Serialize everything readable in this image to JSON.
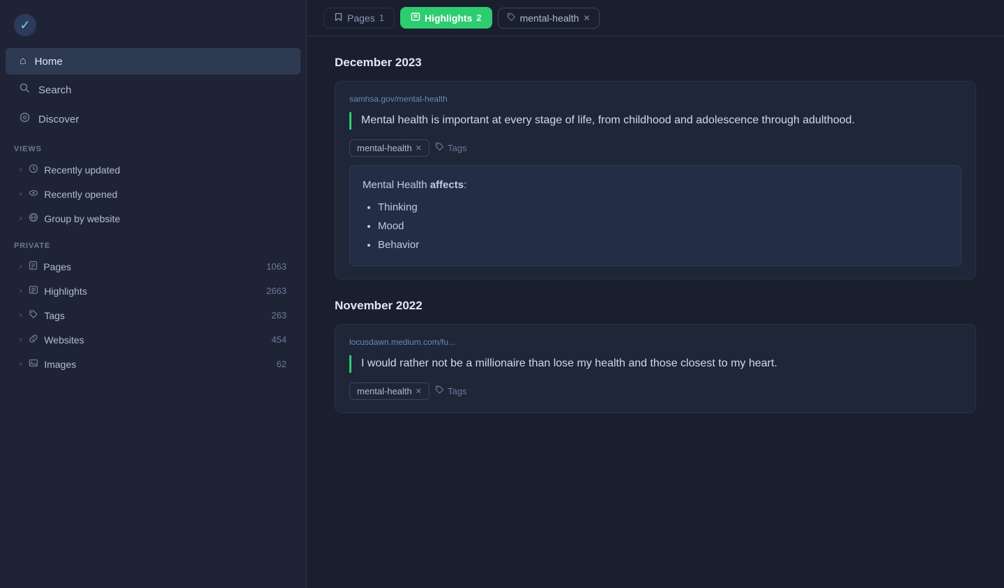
{
  "app": {
    "logo": "☁"
  },
  "sidebar": {
    "nav": [
      {
        "id": "home",
        "icon": "⌂",
        "label": "Home",
        "active": false
      },
      {
        "id": "search",
        "icon": "○",
        "label": "Search",
        "active": false
      },
      {
        "id": "discover",
        "icon": "◎",
        "label": "Discover",
        "active": false
      }
    ],
    "views_label": "Views",
    "views": [
      {
        "id": "recently-updated",
        "icon": "⊙",
        "label": "Recently updated"
      },
      {
        "id": "recently-opened",
        "icon": "◉",
        "label": "Recently opened"
      },
      {
        "id": "group-by-website",
        "icon": "⊕",
        "label": "Group by website"
      }
    ],
    "private_label": "Private",
    "private_items": [
      {
        "id": "pages",
        "icon": "📄",
        "label": "Pages",
        "count": "1063"
      },
      {
        "id": "highlights",
        "icon": "❝",
        "label": "Highlights",
        "count": "2663"
      },
      {
        "id": "tags",
        "icon": "🏷",
        "label": "Tags",
        "count": "263"
      },
      {
        "id": "websites",
        "icon": "🔗",
        "label": "Websites",
        "count": "454"
      },
      {
        "id": "images",
        "icon": "🖼",
        "label": "Images",
        "count": "62"
      }
    ]
  },
  "topbar": {
    "pages_label": "Pages",
    "pages_count": "1",
    "highlights_label": "Highlights",
    "highlights_count": "2",
    "tag_label": "mental-health"
  },
  "content": {
    "sections": [
      {
        "id": "dec-2023",
        "date": "December 2023",
        "cards": [
          {
            "id": "card-1",
            "url": "samhsa.gov/mental-health",
            "quote": "Mental health is important at every stage of life, from childhood and adolescence through adulthood.",
            "tag": "mental-health",
            "ai_content": {
              "intro": "Mental Health affects:",
              "intro_bold": "affects",
              "items": [
                "Thinking",
                "Mood",
                "Behavior"
              ]
            }
          }
        ]
      },
      {
        "id": "nov-2022",
        "date": "November 2022",
        "cards": [
          {
            "id": "card-2",
            "url": "locusdawn.medium.com/fu...",
            "quote": "I would rather not be a millionaire than lose my health and those closest to my heart.",
            "tag": "mental-health",
            "ai_content": null
          }
        ]
      }
    ],
    "tags_placeholder": "Tags"
  }
}
